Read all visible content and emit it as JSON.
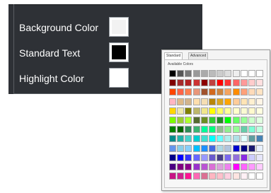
{
  "settings": {
    "rows": [
      {
        "label": "Background Color",
        "color": "#f2f2f2"
      },
      {
        "label": "Standard Text",
        "color": "#000000"
      },
      {
        "label": "Highlight Color",
        "color": "#ffffff"
      }
    ]
  },
  "picker": {
    "tabs": [
      {
        "label": "Standard",
        "active": true
      },
      {
        "label": "Advanced",
        "active": false
      }
    ],
    "section_label": "Available Colors",
    "colors": [
      [
        "#000000",
        "#555555",
        "#777777",
        "#999999",
        "#aaaaaa",
        "#bbbbbb",
        "#cccccc",
        "#dddddd",
        "#eeeeee",
        "#ffffff",
        "#ffffff",
        "#ffffff"
      ],
      [
        "#800000",
        "#a52a2a",
        "#b22222",
        "#cc3333",
        "#8b0000",
        "#c04040",
        "#ff0000",
        "#ff3333",
        "#ff6666",
        "#ff9999",
        "#ffcccc",
        "#ffe0e0"
      ],
      [
        "#ff4500",
        "#ff6347",
        "#ff7f50",
        "#e9967a",
        "#a0522d",
        "#d2691e",
        "#cd853f",
        "#f4a460",
        "#ff8c00",
        "#ffa07a",
        "#ffdab9",
        "#ffe4c4"
      ],
      [
        "#ffb6c1",
        "#deb887",
        "#d2b48c",
        "#ffdead",
        "#f5deb3",
        "#b8860b",
        "#daa520",
        "#ffa500",
        "#ffcc99",
        "#ffe4b5",
        "#fff0d0",
        "#fff5e6"
      ],
      [
        "#ffd700",
        "#eee8aa",
        "#808000",
        "#bdb76b",
        "#f0e68c",
        "#ffff00",
        "#ffff66",
        "#ffff99",
        "#ffffcc",
        "#fafad2",
        "#fffacd",
        "#ffffe0"
      ],
      [
        "#7cfc00",
        "#9acd32",
        "#adff2f",
        "#556b2f",
        "#6b8e23",
        "#32cd32",
        "#228b22",
        "#00ff00",
        "#66ff66",
        "#99ff99",
        "#ccffcc",
        "#e0ffe0"
      ],
      [
        "#008000",
        "#006400",
        "#2e8b57",
        "#3cb371",
        "#00fa9a",
        "#00ff7f",
        "#8fbc8f",
        "#90ee90",
        "#98fb98",
        "#66cdaa",
        "#7fffd4",
        "#c0ffe0"
      ],
      [
        "#008b8b",
        "#20b2aa",
        "#48d1cc",
        "#00ced1",
        "#40e0d0",
        "#00ffff",
        "#66ffff",
        "#afeeee",
        "#b0e0e6",
        "#e0ffff",
        "#5f9ea0",
        "#4682b4"
      ],
      [
        "#6495ed",
        "#87ceeb",
        "#87cefa",
        "#00bfff",
        "#1e90ff",
        "#4169e1",
        "#add8e6",
        "#b0c4de",
        "#0000cd",
        "#000080",
        "#191970",
        "#e6f0ff"
      ],
      [
        "#00008b",
        "#0000ff",
        "#3333ff",
        "#6666ff",
        "#9999ff",
        "#6a5acd",
        "#483d8b",
        "#7b68ee",
        "#9370db",
        "#8a2be2",
        "#ccccff",
        "#e6e6fa"
      ],
      [
        "#4b0082",
        "#800080",
        "#8b008b",
        "#9932cc",
        "#ba55d3",
        "#da70d6",
        "#dda0dd",
        "#ee82ee",
        "#ff00ff",
        "#ff66ff",
        "#ff99ff",
        "#ffccff"
      ],
      [
        "#c71585",
        "#d02090",
        "#ff1493",
        "#ff69b4",
        "#db7093",
        "#ffb6c1",
        "#ffc0cb",
        "#ffd0e0",
        "#ffe4e1",
        "#fff0f5",
        "#ffffff",
        "#ffffff"
      ]
    ]
  }
}
